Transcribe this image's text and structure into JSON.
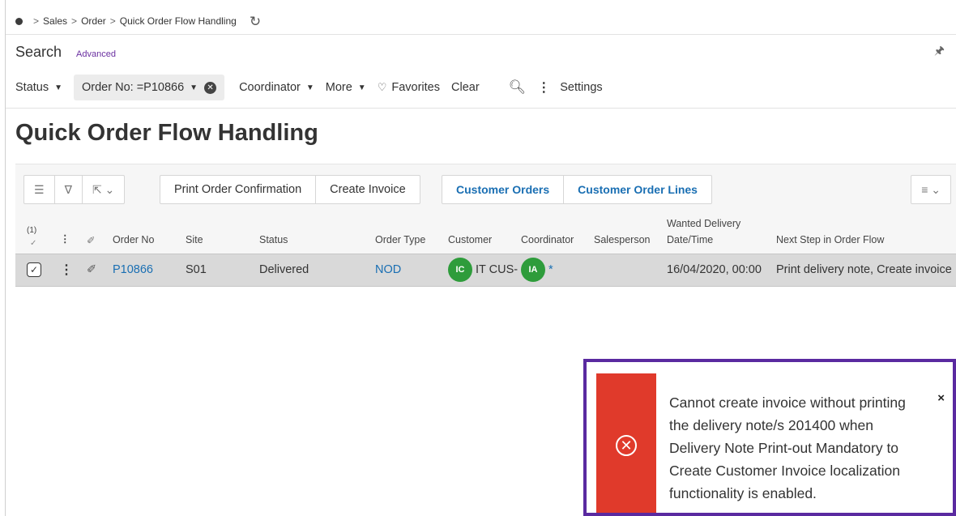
{
  "breadcrumb": {
    "items": [
      "Sales",
      "Order",
      "Quick Order Flow Handling"
    ]
  },
  "search": {
    "title": "Search",
    "advanced": "Advanced"
  },
  "filters": {
    "status": "Status",
    "order_no": "Order No: =P10866",
    "coordinator": "Coordinator",
    "more": "More",
    "favorites": "Favorites",
    "clear": "Clear",
    "settings": "Settings"
  },
  "page_title": "Quick Order Flow Handling",
  "toolbar": {
    "print_order_confirmation": "Print Order Confirmation",
    "create_invoice": "Create Invoice",
    "customer_orders": "Customer Orders",
    "customer_order_lines": "Customer Order Lines"
  },
  "grid": {
    "selected_count": "(1)",
    "columns": {
      "order_no": "Order No",
      "site": "Site",
      "status": "Status",
      "order_type": "Order Type",
      "customer": "Customer",
      "coordinator": "Coordinator",
      "salesperson": "Salesperson",
      "wanted_delivery_1": "Wanted Delivery",
      "wanted_delivery_2": "Date/Time",
      "next_step": "Next Step in Order Flow"
    },
    "row": {
      "order_no": "P10866",
      "site": "S01",
      "status": "Delivered",
      "order_type": "NOD",
      "customer_initials": "IC",
      "customer": "IT CUS-",
      "coordinator_initials": "IA",
      "coordinator_suffix": "*",
      "wanted_delivery": "16/04/2020, 00:00",
      "next_step": "Print delivery note, Create invoice"
    }
  },
  "toast": {
    "message": "Cannot create invoice without printing the delivery note/s 201400 when Delivery Note Print-out Mandatory to Create Customer Invoice localization functionality is enabled.",
    "close": "×"
  },
  "colors": {
    "accent_link": "#1a6fb3",
    "avatar_green": "#2e9c3b",
    "error_red": "#e03a2b",
    "highlight_purple": "#5a2aa0"
  }
}
